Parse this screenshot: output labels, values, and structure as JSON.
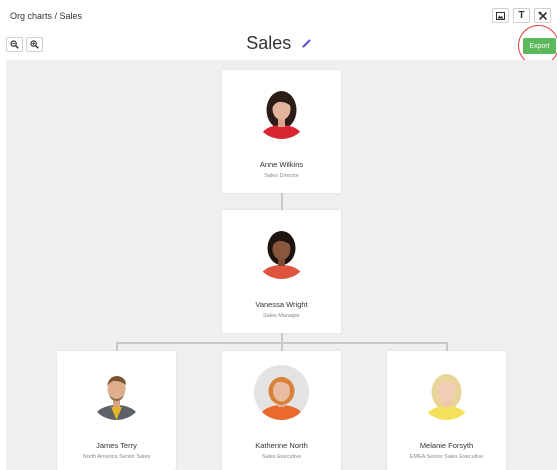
{
  "breadcrumb": "Org charts / Sales",
  "top_tools": [
    {
      "icon": "image-icon"
    },
    {
      "icon": "text-icon",
      "glyph": "T"
    },
    {
      "icon": "tools-icon"
    }
  ],
  "zoom": {
    "zoom_out_icon": "zoom-out-icon",
    "zoom_in_icon": "zoom-in-icon"
  },
  "title": "Sales",
  "export_label": "Export",
  "colors": {
    "export": "#5cb85c",
    "highlight_ring": "#e33b3b",
    "pencil": "#5b4fcf"
  },
  "people": [
    {
      "name": "Anne Wilkins",
      "role": "Sales Director"
    },
    {
      "name": "Vanessa Wright",
      "role": "Sales Manager"
    },
    {
      "name": "James Terry",
      "role": "North America Senior Sales"
    },
    {
      "name": "Katherine North",
      "role": "Sales Executive"
    },
    {
      "name": "Melanie Forsyth",
      "role": "EMEA Senior Sales Executive"
    }
  ]
}
